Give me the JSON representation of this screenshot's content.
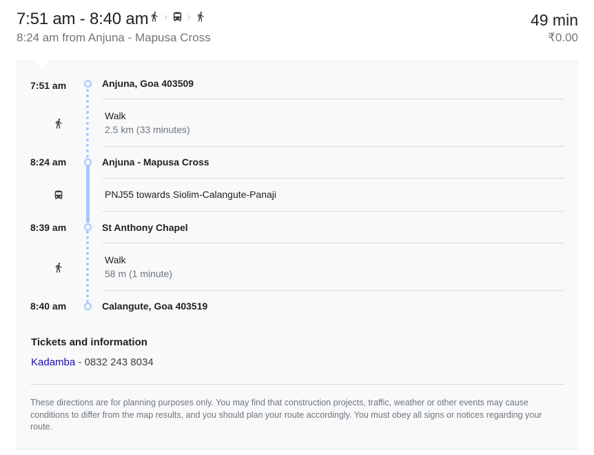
{
  "header": {
    "time_range": "7:51 am - 8:40 am",
    "departure": "8:24 am from Anjuna - Mapusa Cross",
    "duration": "49 min",
    "fare": "₹0.00",
    "mode_icons": [
      "walk-icon",
      "bus-icon",
      "walk-icon"
    ]
  },
  "itinerary": {
    "stops": [
      {
        "time": "7:51 am",
        "name": "Anjuna, Goa 403509"
      },
      {
        "time": "8:24 am",
        "name": "Anjuna - Mapusa Cross"
      },
      {
        "time": "8:39 am",
        "name": "St Anthony Chapel"
      },
      {
        "time": "8:40 am",
        "name": "Calangute, Goa 403519"
      }
    ],
    "steps": [
      {
        "mode": "walk-icon",
        "title": "Walk",
        "detail": "2.5 km (33 minutes)"
      },
      {
        "mode": "bus-icon",
        "title": "PNJ55 towards Siolim-Calangute-Panaji"
      },
      {
        "mode": "walk-icon",
        "title": "Walk",
        "detail": "58 m (1 minute)"
      }
    ]
  },
  "tickets": {
    "heading": "Tickets and information",
    "agency": "Kadamba",
    "separator": " - ",
    "phone": "0832 243 8034"
  },
  "disclaimer": "These directions are for planning purposes only. You may find that construction projects, traffic, weather or other events may cause conditions to differ from the map results, and you should plan your route accordingly. You must obey all signs or notices regarding your route.",
  "colors": {
    "rail": "#a8c7fa",
    "link": "#1a0dab",
    "panel": "#f8f9fa"
  }
}
